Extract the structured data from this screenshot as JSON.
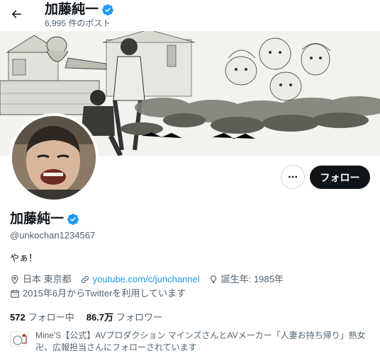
{
  "header": {
    "title": "加藤純一",
    "post_count": "6,995 件のポスト"
  },
  "actions": {
    "more_label": "…",
    "follow_label": "フォロー"
  },
  "profile": {
    "name": "加藤純一",
    "handle": "@unkochan1234567",
    "bio": "やぁ！",
    "location": "日本 東京都",
    "website": "youtube.com/c/junchannel",
    "birthday": "誕生年: 1985年",
    "joined": "2015年6月からTwitterを利用しています",
    "following_count": "572",
    "following_label": "フォロー中",
    "followers_count": "86.7万",
    "followers_label": "フォロワー",
    "followed_by": "Mine'S【公式】AVプロダクション マインズさんとAVメーカー「人妻お持ち帰り」熟女卍、広報担当さんにフォローされています"
  },
  "colors": {
    "accent": "#1d9bf0",
    "text": "#0f1419",
    "muted": "#536471",
    "button": "#0f1419"
  },
  "icons": [
    "back-arrow-icon",
    "verified-badge-icon",
    "more-icon",
    "location-icon",
    "link-icon",
    "birthday-icon",
    "calendar-icon"
  ]
}
